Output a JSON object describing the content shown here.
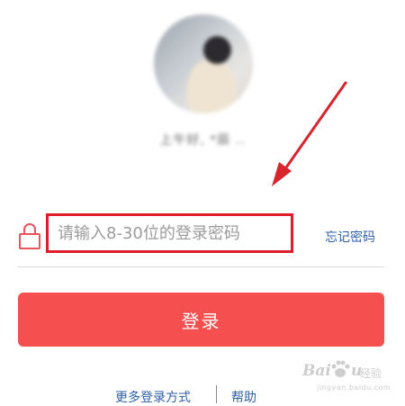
{
  "profile": {
    "greeting": "上午好, *辰 .."
  },
  "password": {
    "placeholder": "请输入8-30位的登录密码",
    "forgot_label": "忘记密码"
  },
  "login_button": "登录",
  "footer": {
    "more_methods": "更多登录方式",
    "help": "帮助"
  },
  "watermark": {
    "brand": "Bai",
    "brand_end": "u",
    "cn": "经验",
    "url": "jingyan.baidu.com"
  },
  "colors": {
    "accent_red": "#f54f4f",
    "highlight_box": "#e01e2b",
    "link_blue": "#2f5fa5",
    "lock_icon": "#e8555a"
  },
  "icons": {
    "lock": "lock-icon",
    "annotation_arrow": "arrow-icon",
    "watermark_paw": "paw-icon"
  }
}
